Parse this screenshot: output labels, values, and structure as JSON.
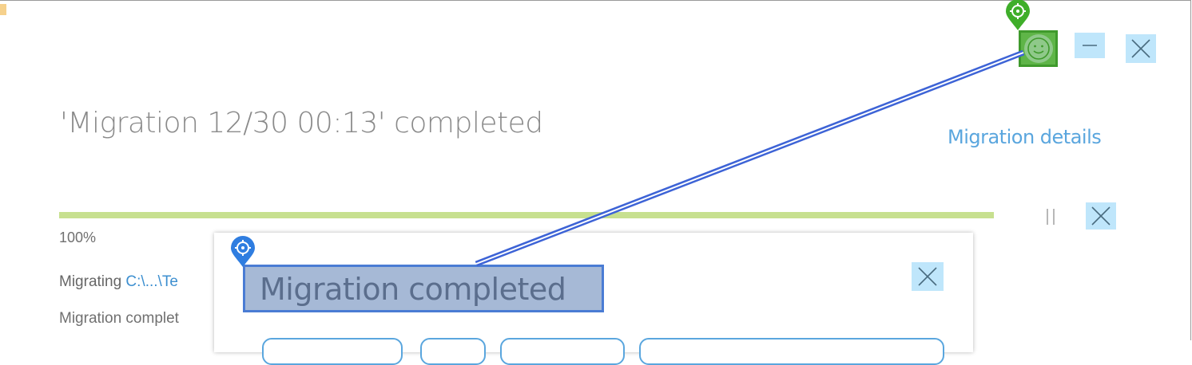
{
  "window": {
    "title": "'Migration 12/30 00:13' completed",
    "details_link": "Migration details",
    "buttons": [
      "feedback",
      "minimize",
      "close"
    ]
  },
  "progress": {
    "fraction": 1.0,
    "percent_label": "100%",
    "pause_glyph": "||"
  },
  "migrating": {
    "prefix": "Migrating ",
    "path": "C:\\...\\Te"
  },
  "status_line": "Migration complet",
  "toast": {
    "title": "Migration completed"
  },
  "colors": {
    "accent": "#5aa6de",
    "progress": "#c7e08f",
    "button_bg": "#bfe6fb",
    "highlight_green": "#5fb548",
    "highlight_blue": "#4a7cd4"
  },
  "icons": [
    "smiley-icon",
    "minimize-icon",
    "close-icon",
    "pause-icon",
    "cancel-icon",
    "toast-close-icon",
    "target-marker-icon"
  ]
}
